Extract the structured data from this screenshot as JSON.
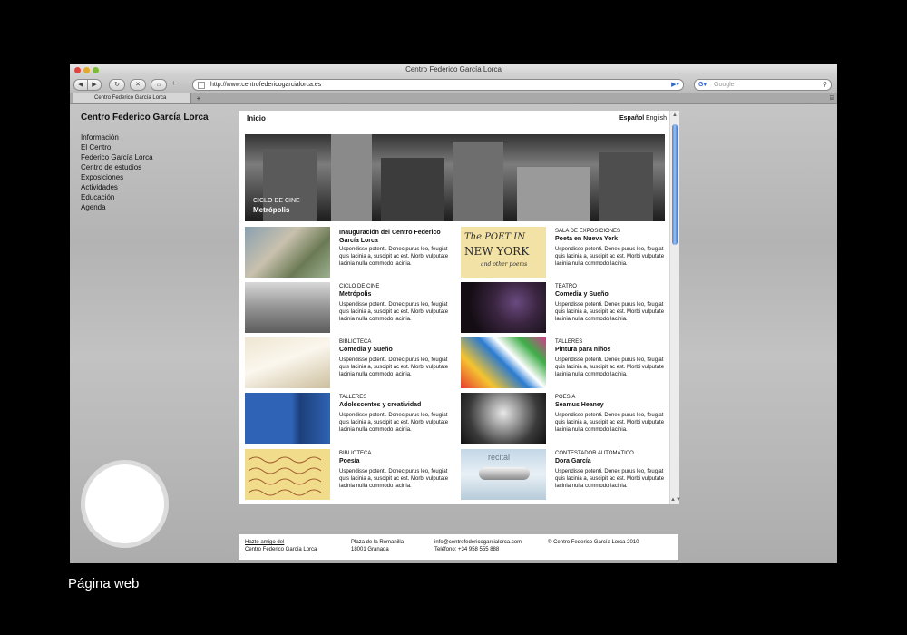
{
  "browser": {
    "window_title": "Centro Federico García Lorca",
    "url": "http://www.centrofedericogarcialorca.es",
    "search_placeholder": "Google",
    "search_engine_icon": "google-icon",
    "tab_label": "Centro Federico García Lorca"
  },
  "site": {
    "title": "Centro Federico García Lorca",
    "nav": [
      "Información",
      "El Centro",
      "Federico García Lorca",
      "Centro de estudios",
      "Exposiciones",
      "Actividades",
      "Educación",
      "Agenda"
    ]
  },
  "content": {
    "section": "Inicio",
    "lang_es": "Español",
    "lang_en": "English",
    "hero": {
      "category": "CICLO DE CINE",
      "title": "Metrópolis"
    },
    "items": [
      {
        "category": "",
        "title": "Inauguración del Centro Federico García Lorca",
        "body": "Uspendisse potenti. Donec purus leo, feugiat quis lacinia a, suscipit ac est. Morbi vulputate lacinia nulla commodo lacinia."
      },
      {
        "category": "SALA DE EXPOSICIONES",
        "title": "Poeta en Nueva York",
        "body": "Uspendisse potenti. Donec purus leo, feugiat quis lacinia a, suscipit ac est. Morbi vulputate lacinia nulla commodo lacinia.",
        "thumb_text": {
          "line1": "The POET IN",
          "line2": "NEW YORK",
          "line3": "and other poems"
        }
      },
      {
        "category": "CICLO DE CINE",
        "title": "Metrópolis",
        "body": "Uspendisse potenti. Donec purus leo, feugiat quis lacinia a, suscipit ac est. Morbi vulputate lacinia nulla commodo lacinia."
      },
      {
        "category": "TEATRO",
        "title": "Comedia y Sueño",
        "body": "Uspendisse potenti. Donec purus leo, feugiat quis lacinia a, suscipit ac est. Morbi vulputate lacinia nulla commodo lacinia."
      },
      {
        "category": "BIBLIOTECA",
        "title": "Comedia y Sueño",
        "body": "Uspendisse potenti. Donec purus leo, feugiat quis lacinia a, suscipit ac est. Morbi vulputate lacinia nulla commodo lacinia."
      },
      {
        "category": "TALLERES",
        "title": "Pintura para niños",
        "body": "Uspendisse potenti. Donec purus leo, feugiat quis lacinia a, suscipit ac est. Morbi vulputate lacinia nulla commodo lacinia."
      },
      {
        "category": "TALLERES",
        "title": "Adolescentes y creatividad",
        "body": "Uspendisse potenti. Donec purus leo, feugiat quis lacinia a, suscipit ac est. Morbi vulputate lacinia nulla commodo lacinia."
      },
      {
        "category": "POESÍA",
        "title": "Seamus Heaney",
        "body": "Uspendisse potenti. Donec purus leo, feugiat quis lacinia a, suscipit ac est. Morbi vulputate lacinia nulla commodo lacinia."
      },
      {
        "category": "BIBLIOTECA",
        "title": "Poesía",
        "body": "Uspendisse potenti. Donec purus leo, feugiat quis lacinia a, suscipit ac est. Morbi vulputate lacinia nulla commodo lacinia."
      },
      {
        "category": "CONTESTADOR AUTOMÁTICO",
        "title": "Dora García",
        "body": "Uspendisse potenti. Donec purus leo, feugiat quis lacinia a, suscipit ac est. Morbi vulputate lacinia nulla commodo lacinia.",
        "thumb_text": {
          "line1": "recital"
        }
      }
    ]
  },
  "footer": {
    "friend_line1": "Hazte amigo del",
    "friend_line2": "Centro Federico García Lorca",
    "address_line1": "Plaza de la Romanilla",
    "address_line2": "18001 Granada",
    "email": "info@centrofedericogarcialorca.com",
    "phone": "Teléfono: +34 958 555 888",
    "copyright": "© Centro Federico García Lorca 2010"
  },
  "caption": "Página web",
  "colors": {
    "scroll_thumb": "#4a84d8",
    "page_bg": "#000000"
  }
}
